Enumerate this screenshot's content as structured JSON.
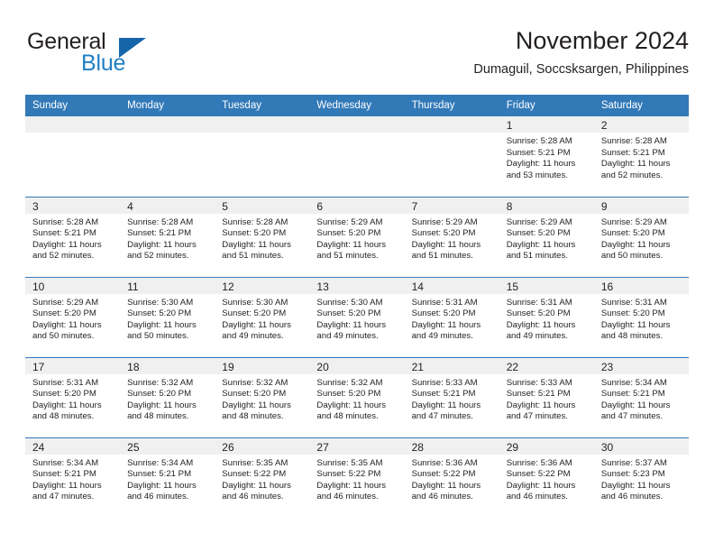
{
  "brand": {
    "word_one": "General",
    "word_two": "Blue",
    "triangle_color": "#1565a8",
    "blue_text_color": "#1f7fc4"
  },
  "header": {
    "title": "November 2024",
    "subtitle": "Dumaguil, Soccsksargen, Philippines"
  },
  "theme": {
    "header_bg": "#3279b8",
    "daynum_bg": "#f0f0f0",
    "text": "#231f20"
  },
  "weekday_headers": [
    "Sunday",
    "Monday",
    "Tuesday",
    "Wednesday",
    "Thursday",
    "Friday",
    "Saturday"
  ],
  "weeks": [
    [
      {
        "day": "",
        "sunrise": "",
        "sunset": "",
        "daylight": "",
        "empty": true
      },
      {
        "day": "",
        "sunrise": "",
        "sunset": "",
        "daylight": "",
        "empty": true
      },
      {
        "day": "",
        "sunrise": "",
        "sunset": "",
        "daylight": "",
        "empty": true
      },
      {
        "day": "",
        "sunrise": "",
        "sunset": "",
        "daylight": "",
        "empty": true
      },
      {
        "day": "",
        "sunrise": "",
        "sunset": "",
        "daylight": "",
        "empty": true
      },
      {
        "day": "1",
        "sunrise": "Sunrise: 5:28 AM",
        "sunset": "Sunset: 5:21 PM",
        "daylight": "Daylight: 11 hours and 53 minutes.",
        "empty": false
      },
      {
        "day": "2",
        "sunrise": "Sunrise: 5:28 AM",
        "sunset": "Sunset: 5:21 PM",
        "daylight": "Daylight: 11 hours and 52 minutes.",
        "empty": false
      }
    ],
    [
      {
        "day": "3",
        "sunrise": "Sunrise: 5:28 AM",
        "sunset": "Sunset: 5:21 PM",
        "daylight": "Daylight: 11 hours and 52 minutes.",
        "empty": false
      },
      {
        "day": "4",
        "sunrise": "Sunrise: 5:28 AM",
        "sunset": "Sunset: 5:21 PM",
        "daylight": "Daylight: 11 hours and 52 minutes.",
        "empty": false
      },
      {
        "day": "5",
        "sunrise": "Sunrise: 5:28 AM",
        "sunset": "Sunset: 5:20 PM",
        "daylight": "Daylight: 11 hours and 51 minutes.",
        "empty": false
      },
      {
        "day": "6",
        "sunrise": "Sunrise: 5:29 AM",
        "sunset": "Sunset: 5:20 PM",
        "daylight": "Daylight: 11 hours and 51 minutes.",
        "empty": false
      },
      {
        "day": "7",
        "sunrise": "Sunrise: 5:29 AM",
        "sunset": "Sunset: 5:20 PM",
        "daylight": "Daylight: 11 hours and 51 minutes.",
        "empty": false
      },
      {
        "day": "8",
        "sunrise": "Sunrise: 5:29 AM",
        "sunset": "Sunset: 5:20 PM",
        "daylight": "Daylight: 11 hours and 51 minutes.",
        "empty": false
      },
      {
        "day": "9",
        "sunrise": "Sunrise: 5:29 AM",
        "sunset": "Sunset: 5:20 PM",
        "daylight": "Daylight: 11 hours and 50 minutes.",
        "empty": false
      }
    ],
    [
      {
        "day": "10",
        "sunrise": "Sunrise: 5:29 AM",
        "sunset": "Sunset: 5:20 PM",
        "daylight": "Daylight: 11 hours and 50 minutes.",
        "empty": false
      },
      {
        "day": "11",
        "sunrise": "Sunrise: 5:30 AM",
        "sunset": "Sunset: 5:20 PM",
        "daylight": "Daylight: 11 hours and 50 minutes.",
        "empty": false
      },
      {
        "day": "12",
        "sunrise": "Sunrise: 5:30 AM",
        "sunset": "Sunset: 5:20 PM",
        "daylight": "Daylight: 11 hours and 49 minutes.",
        "empty": false
      },
      {
        "day": "13",
        "sunrise": "Sunrise: 5:30 AM",
        "sunset": "Sunset: 5:20 PM",
        "daylight": "Daylight: 11 hours and 49 minutes.",
        "empty": false
      },
      {
        "day": "14",
        "sunrise": "Sunrise: 5:31 AM",
        "sunset": "Sunset: 5:20 PM",
        "daylight": "Daylight: 11 hours and 49 minutes.",
        "empty": false
      },
      {
        "day": "15",
        "sunrise": "Sunrise: 5:31 AM",
        "sunset": "Sunset: 5:20 PM",
        "daylight": "Daylight: 11 hours and 49 minutes.",
        "empty": false
      },
      {
        "day": "16",
        "sunrise": "Sunrise: 5:31 AM",
        "sunset": "Sunset: 5:20 PM",
        "daylight": "Daylight: 11 hours and 48 minutes.",
        "empty": false
      }
    ],
    [
      {
        "day": "17",
        "sunrise": "Sunrise: 5:31 AM",
        "sunset": "Sunset: 5:20 PM",
        "daylight": "Daylight: 11 hours and 48 minutes.",
        "empty": false
      },
      {
        "day": "18",
        "sunrise": "Sunrise: 5:32 AM",
        "sunset": "Sunset: 5:20 PM",
        "daylight": "Daylight: 11 hours and 48 minutes.",
        "empty": false
      },
      {
        "day": "19",
        "sunrise": "Sunrise: 5:32 AM",
        "sunset": "Sunset: 5:20 PM",
        "daylight": "Daylight: 11 hours and 48 minutes.",
        "empty": false
      },
      {
        "day": "20",
        "sunrise": "Sunrise: 5:32 AM",
        "sunset": "Sunset: 5:20 PM",
        "daylight": "Daylight: 11 hours and 48 minutes.",
        "empty": false
      },
      {
        "day": "21",
        "sunrise": "Sunrise: 5:33 AM",
        "sunset": "Sunset: 5:21 PM",
        "daylight": "Daylight: 11 hours and 47 minutes.",
        "empty": false
      },
      {
        "day": "22",
        "sunrise": "Sunrise: 5:33 AM",
        "sunset": "Sunset: 5:21 PM",
        "daylight": "Daylight: 11 hours and 47 minutes.",
        "empty": false
      },
      {
        "day": "23",
        "sunrise": "Sunrise: 5:34 AM",
        "sunset": "Sunset: 5:21 PM",
        "daylight": "Daylight: 11 hours and 47 minutes.",
        "empty": false
      }
    ],
    [
      {
        "day": "24",
        "sunrise": "Sunrise: 5:34 AM",
        "sunset": "Sunset: 5:21 PM",
        "daylight": "Daylight: 11 hours and 47 minutes.",
        "empty": false
      },
      {
        "day": "25",
        "sunrise": "Sunrise: 5:34 AM",
        "sunset": "Sunset: 5:21 PM",
        "daylight": "Daylight: 11 hours and 46 minutes.",
        "empty": false
      },
      {
        "day": "26",
        "sunrise": "Sunrise: 5:35 AM",
        "sunset": "Sunset: 5:22 PM",
        "daylight": "Daylight: 11 hours and 46 minutes.",
        "empty": false
      },
      {
        "day": "27",
        "sunrise": "Sunrise: 5:35 AM",
        "sunset": "Sunset: 5:22 PM",
        "daylight": "Daylight: 11 hours and 46 minutes.",
        "empty": false
      },
      {
        "day": "28",
        "sunrise": "Sunrise: 5:36 AM",
        "sunset": "Sunset: 5:22 PM",
        "daylight": "Daylight: 11 hours and 46 minutes.",
        "empty": false
      },
      {
        "day": "29",
        "sunrise": "Sunrise: 5:36 AM",
        "sunset": "Sunset: 5:22 PM",
        "daylight": "Daylight: 11 hours and 46 minutes.",
        "empty": false
      },
      {
        "day": "30",
        "sunrise": "Sunrise: 5:37 AM",
        "sunset": "Sunset: 5:23 PM",
        "daylight": "Daylight: 11 hours and 46 minutes.",
        "empty": false
      }
    ]
  ]
}
